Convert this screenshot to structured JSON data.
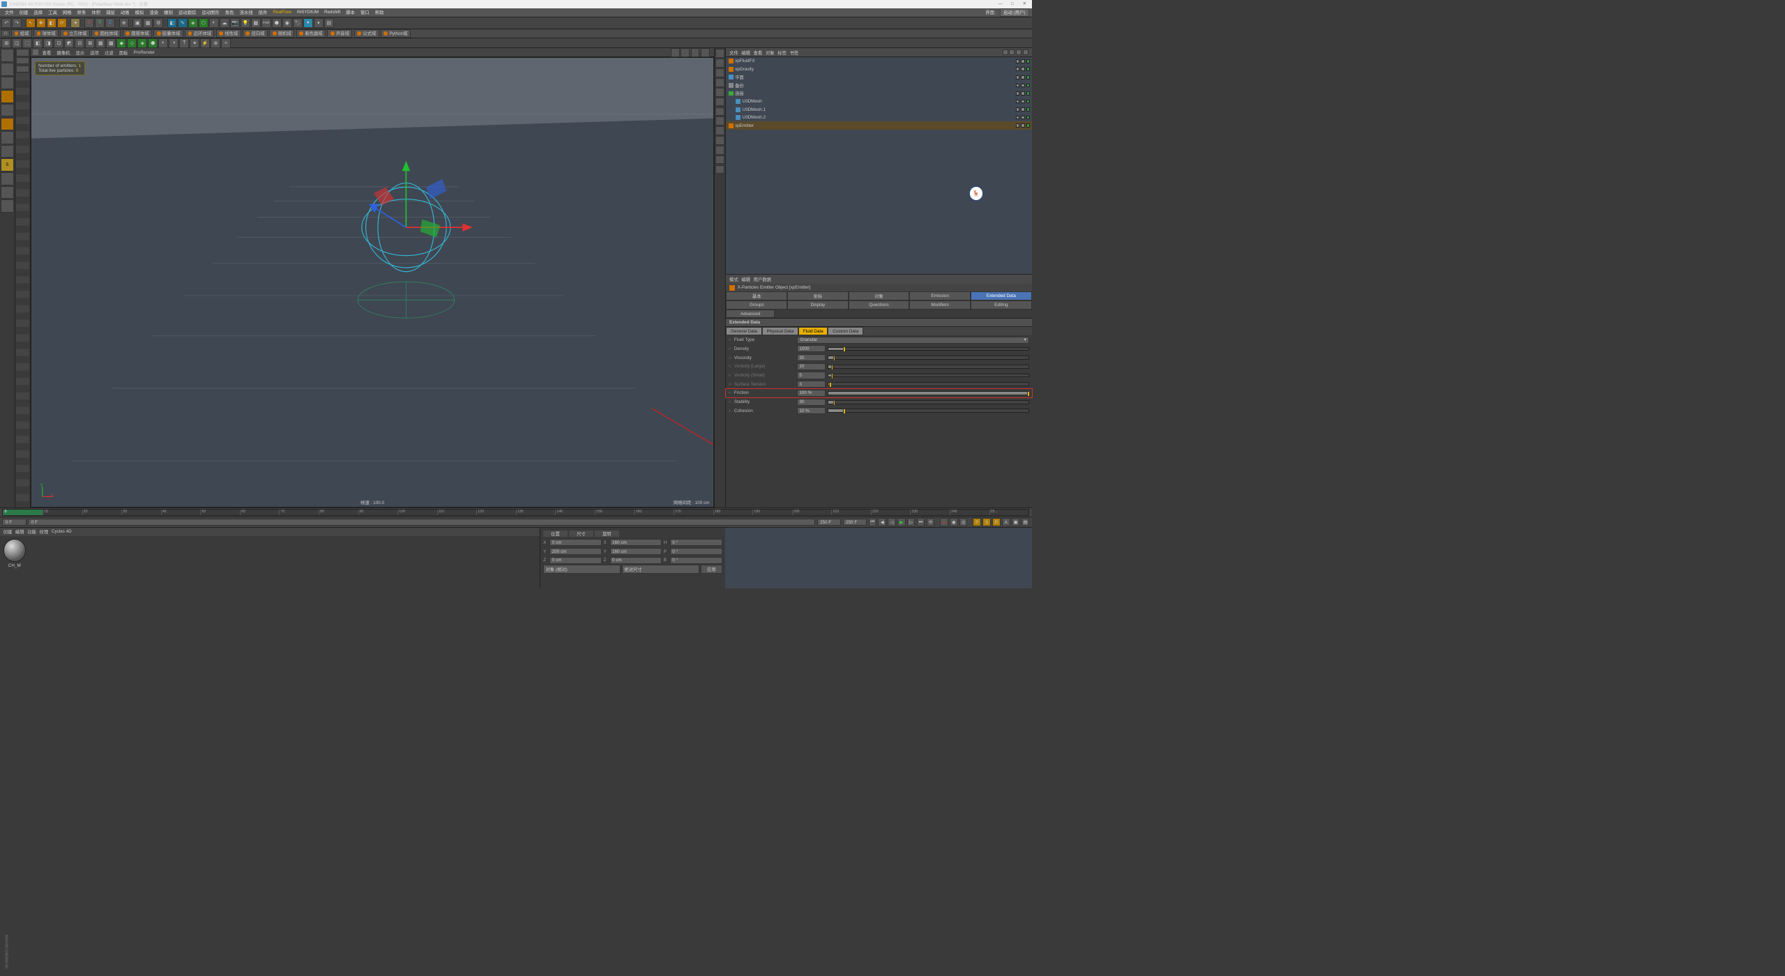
{
  "window": {
    "title": "CINEMA 4D R20.059 Studio (RC - R20) - [PolarBear-Walk.fbx *] - 主要",
    "min": "—",
    "max": "□",
    "close": "✕"
  },
  "menu": {
    "items": [
      "文件",
      "创建",
      "选择",
      "工具",
      "网格",
      "样条",
      "体积",
      "捕捉",
      "动画",
      "模拟",
      "渲染",
      "雕刻",
      "运动跟踪",
      "运动图形",
      "角色",
      "流水线",
      "插件",
      "RealFlow",
      "INSYDIUM",
      "Redshift",
      "脚本",
      "窗口",
      "帮助"
    ],
    "highlight_index": 17,
    "layout_label": "界面:",
    "layout_value": "启动 (用户)"
  },
  "fieldbar": {
    "items": [
      "组域",
      "球体域",
      "立方体域",
      "圆柱体域",
      "圆锥体域",
      "胶囊体域",
      "远环体域",
      "线性域",
      "径向域",
      "随机域",
      "着色器域",
      "声音域",
      "公式域",
      "Python域"
    ]
  },
  "viewmenu": {
    "items": [
      "查看",
      "摄像机",
      "显示",
      "选项",
      "过滤",
      "面板",
      "ProRender"
    ]
  },
  "viewport": {
    "emitters_label": "Number of emitters:",
    "emitters_value": "1",
    "particles_label": "Total live particles:",
    "particles_value": "0",
    "fps_label": "帧速 :",
    "fps_value": "100.0",
    "grid_label": "网格间距 :",
    "grid_value": "100 cm",
    "axis_x": "X",
    "axis_y": "Y"
  },
  "objmgr": {
    "menu": [
      "文件",
      "编辑",
      "查看",
      "对象",
      "标签",
      "书签"
    ],
    "items": [
      {
        "name": "xpFluidFX",
        "indent": 0,
        "icon": "#d07000"
      },
      {
        "name": "xpGravity",
        "indent": 0,
        "icon": "#d07000"
      },
      {
        "name": "平面",
        "indent": 0,
        "icon": "#4a90c0"
      },
      {
        "name": "备份",
        "indent": 0,
        "icon": "#888"
      },
      {
        "name": "连接",
        "indent": 0,
        "icon": "#3aaa3a"
      },
      {
        "name": "U3DMesh",
        "indent": 1,
        "icon": "#4a90c0"
      },
      {
        "name": "U3DMesh.1",
        "indent": 1,
        "icon": "#4a90c0"
      },
      {
        "name": "U3DMesh.2",
        "indent": 1,
        "icon": "#4a90c0"
      },
      {
        "name": "xpEmitter",
        "indent": 0,
        "icon": "#d07000",
        "sel": true
      }
    ]
  },
  "attr": {
    "menu": [
      "模式",
      "编辑",
      "用户数据"
    ],
    "object_title": "X-Particles Emitter Object [xpEmitter]",
    "tabs_row1": [
      "基本",
      "坐标",
      "对象",
      "Emission",
      "Extended Data"
    ],
    "tabs_row2": [
      "Groups",
      "Display",
      "Questions",
      "Modifiers",
      "Editing"
    ],
    "tabs_row3": [
      "Advanced"
    ],
    "selected_tab": "Extended Data",
    "section": "Extended Data",
    "subtabs": [
      "General Data",
      "Physical Data",
      "Fluid Data",
      "Custom Data"
    ],
    "subtab_sel": "Fluid Data",
    "props": [
      {
        "label": "Fluid Type",
        "type": "select",
        "value": "Granular"
      },
      {
        "label": "Density",
        "type": "num",
        "value": "1000",
        "slider": 8
      },
      {
        "label": "Viscosity",
        "type": "num",
        "value": "30",
        "slider": 3
      },
      {
        "label": "Vorticity (Large)",
        "type": "num",
        "value": "10",
        "slider": 2,
        "dim": true
      },
      {
        "label": "Vorticity (Small)",
        "type": "num",
        "value": "5",
        "slider": 2,
        "dim": true
      },
      {
        "label": "Surface Tension",
        "type": "num",
        "value": "3",
        "slider": 1,
        "dim": true
      },
      {
        "label": "Friction",
        "type": "num",
        "value": "100 %",
        "slider": 100,
        "hl": true
      },
      {
        "label": "Stability",
        "type": "num",
        "value": "30",
        "slider": 3
      },
      {
        "label": "Cohesion",
        "type": "num",
        "value": "10 %",
        "slider": 8
      }
    ]
  },
  "timeline": {
    "ticks": [
      "0",
      "10",
      "20",
      "30",
      "40",
      "50",
      "60",
      "70",
      "80",
      "90",
      "100",
      "110",
      "120",
      "130",
      "140",
      "150",
      "160",
      "170",
      "180",
      "190",
      "200",
      "210",
      "220",
      "230",
      "240",
      "25..."
    ],
    "start": "0 F",
    "current": "0 F",
    "end": "250 F",
    "range_end": "250 F"
  },
  "material": {
    "menu": [
      "创建",
      "编辑",
      "功能",
      "纹理",
      "Cycles 4D"
    ],
    "name": "CH_M"
  },
  "coord": {
    "headers": [
      "位置",
      "尺寸",
      "旋转"
    ],
    "rows": [
      {
        "a": "X",
        "av": "0 cm",
        "b": "X",
        "bv": "160 cm",
        "c": "H",
        "cv": "0 °"
      },
      {
        "a": "Y",
        "av": "200 cm",
        "b": "Y",
        "bv": "160 cm",
        "c": "P",
        "cv": "0 °"
      },
      {
        "a": "Z",
        "av": "0 cm",
        "b": "Z",
        "bv": "0 cm",
        "c": "B",
        "cv": "0 °"
      }
    ],
    "sel1": "对象 (相对)",
    "sel2": "绝对尺寸",
    "apply": "应用"
  }
}
